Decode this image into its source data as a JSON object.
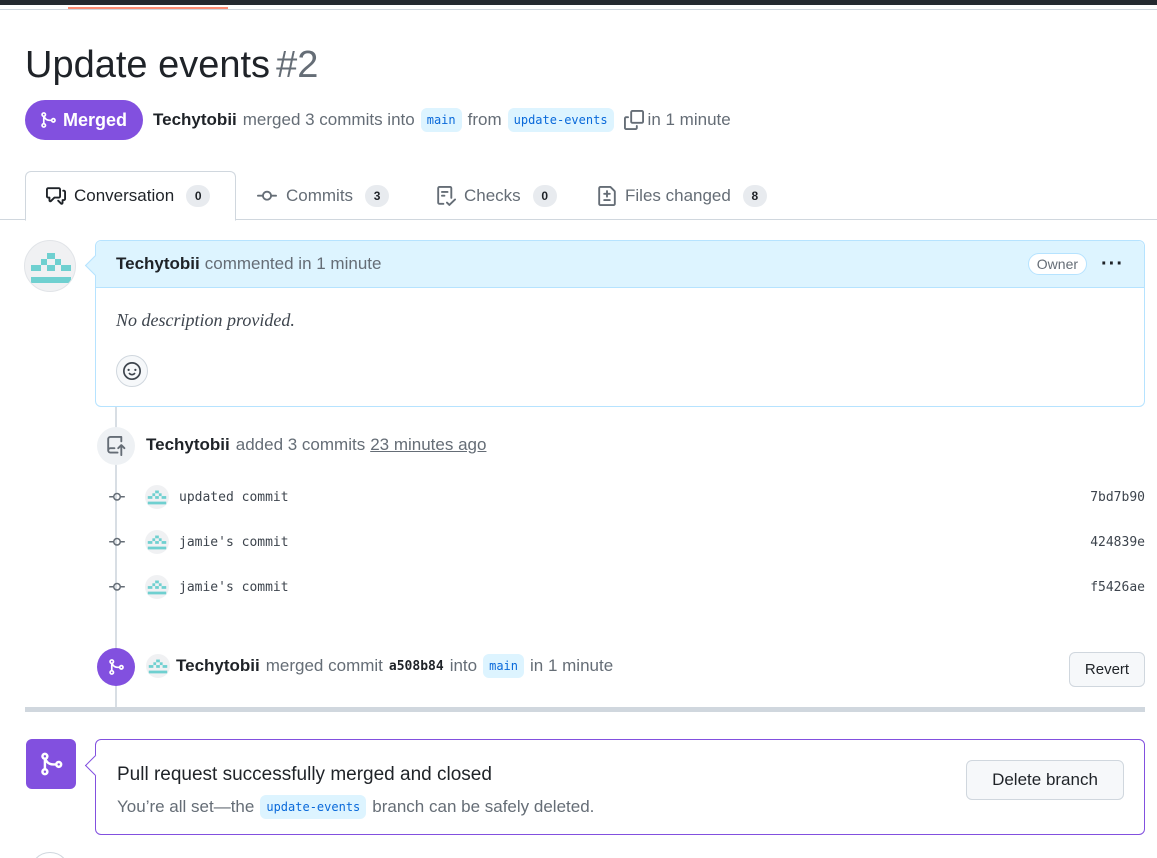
{
  "pr": {
    "title": "Update events",
    "number": "#2",
    "state": "Merged",
    "author": "Techytobii",
    "merge_text": "merged 3 commits into",
    "base_branch": "main",
    "from_text": "from",
    "head_branch": "update-events",
    "time": "in 1 minute"
  },
  "tabs": [
    {
      "label": "Conversation",
      "count": "0"
    },
    {
      "label": "Commits",
      "count": "3"
    },
    {
      "label": "Checks",
      "count": "0"
    },
    {
      "label": "Files changed",
      "count": "8"
    }
  ],
  "comment": {
    "author": "Techytobii",
    "action": "commented in 1 minute",
    "badge": "Owner",
    "body": "No description provided."
  },
  "commits_event": {
    "author": "Techytobii",
    "action": "added 3 commits",
    "time": "23 minutes ago"
  },
  "commits": [
    {
      "message": "updated commit",
      "sha": "7bd7b90"
    },
    {
      "message": "jamie's commit",
      "sha": "424839e"
    },
    {
      "message": "jamie's commit",
      "sha": "f5426ae"
    }
  ],
  "merge_event": {
    "author": "Techytobii",
    "action": "merged commit",
    "sha": "a508b84",
    "into": "into",
    "branch": "main",
    "time": "in 1 minute",
    "revert_label": "Revert"
  },
  "merge_box": {
    "title": "Pull request successfully merged and closed",
    "sub_before": "You’re all set—the",
    "branch": "update-events",
    "sub_after": "branch can be safely deleted.",
    "delete_label": "Delete branch"
  },
  "colors": {
    "merged": "#8250df",
    "branch_bg": "#ddf4ff",
    "branch_fg": "#0969da",
    "comment_header": "#ddf4ff"
  }
}
